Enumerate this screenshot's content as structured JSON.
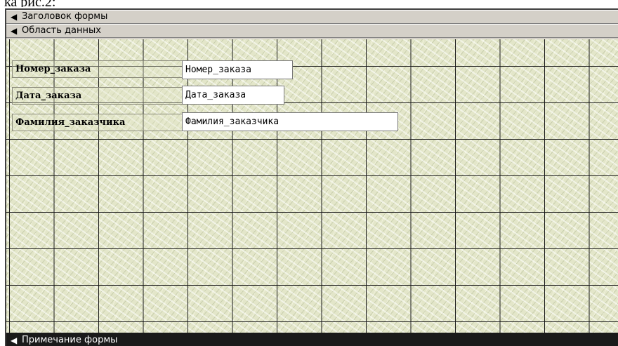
{
  "caption": "ка рис.2:",
  "sections": {
    "form_header": {
      "icon": "section-marker-icon",
      "label": "Заголовок формы"
    },
    "detail": {
      "icon": "section-marker-icon",
      "label": "Область данных"
    },
    "form_footer": {
      "icon": "section-marker-icon",
      "label": "Примечание формы"
    }
  },
  "fields": [
    {
      "label": "Номер_заказа",
      "control": "Номер_заказа"
    },
    {
      "label": "Дата_заказа",
      "control": "Дата_заказа"
    },
    {
      "label": "Фамилия_заказчика",
      "control": "Фамилия_заказчика"
    }
  ],
  "colors": {
    "canvas": "#e3e6c9",
    "grid": "#1a1a1a",
    "section_bar": "#d4d0c8",
    "footer_bar": "#1a1a1a"
  }
}
